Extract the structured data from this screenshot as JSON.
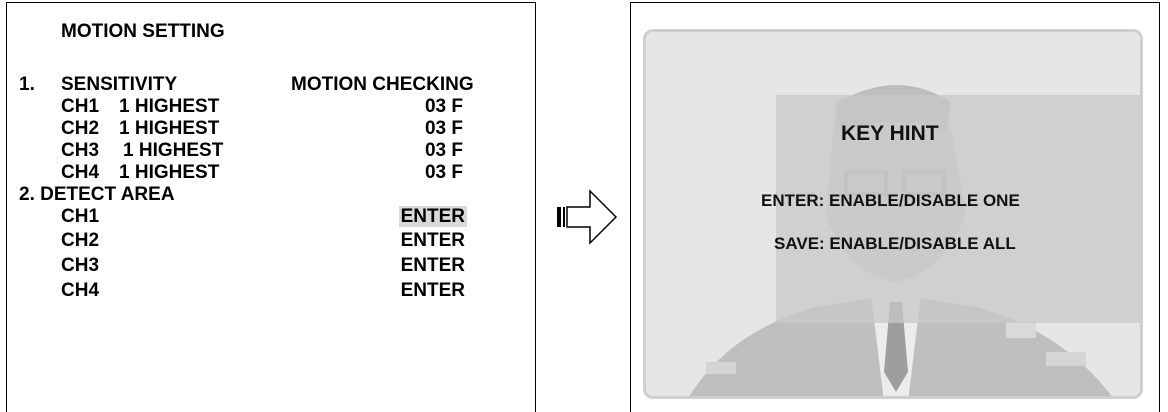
{
  "motion_setting": {
    "title": "MOTION SETTING",
    "section1": {
      "number": "1.",
      "label": "SENSITIVITY",
      "column2": "MOTION CHECKING"
    },
    "sensitivity_rows": [
      {
        "channel": "CH1",
        "value": "1 HIGHEST",
        "checking": "03 F"
      },
      {
        "channel": "CH2",
        "value": "1 HIGHEST",
        "checking": "03 F"
      },
      {
        "channel": "CH3",
        "value": "1 HIGHEST",
        "checking": "03 F"
      },
      {
        "channel": "CH4",
        "value": "1 HIGHEST",
        "checking": "03 F"
      }
    ],
    "section2": {
      "label": "2. DETECT AREA"
    },
    "detect_rows": [
      {
        "channel": "CH1",
        "action": "ENTER"
      },
      {
        "channel": "CH2",
        "action": "ENTER"
      },
      {
        "channel": "CH3",
        "action": "ENTER"
      },
      {
        "channel": "CH4",
        "action": "ENTER"
      }
    ]
  },
  "key_hint": {
    "title": "KEY HINT",
    "line1": "ENTER: ENABLE/DISABLE ONE",
    "line2": "SAVE: ENABLE/DISABLE ALL"
  },
  "colors": {
    "highlight": "#d9d9d9",
    "overlay": "#c8c8c8",
    "text": "#000000"
  },
  "icons": {
    "arrow": "right-arrow-icon"
  }
}
